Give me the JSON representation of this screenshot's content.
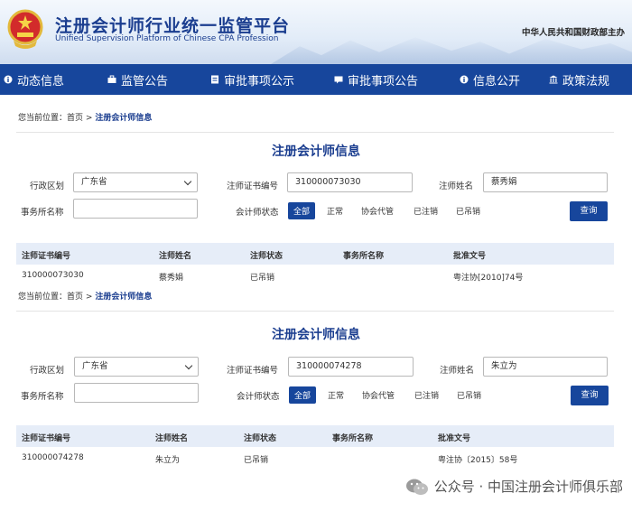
{
  "header": {
    "title": "注册会计师行业统一监管平台",
    "subtitle": "Unified Supervision Platform of Chinese CPA Profession",
    "ministry": "中华人民共和国财政部主办"
  },
  "nav": [
    {
      "label": "动态信息",
      "icon": "info-icon"
    },
    {
      "label": "监管公告",
      "icon": "briefcase-icon"
    },
    {
      "label": "审批事项公示",
      "icon": "document-icon"
    },
    {
      "label": "审批事项公告",
      "icon": "announce-icon"
    },
    {
      "label": "信息公开",
      "icon": "info-icon"
    },
    {
      "label": "政策法规",
      "icon": "building-icon"
    }
  ],
  "sections": [
    {
      "breadcrumb": {
        "prefix": "您当前位置：",
        "home": "首页",
        "sep": ">",
        "current": "注册会计师信息"
      },
      "title": "注册会计师信息",
      "form": {
        "region_label": "行政区划",
        "region_value": "广东省",
        "cert_label": "注师证书编号",
        "cert_value": "310000073030",
        "name_label": "注师姓名",
        "name_value": "蔡秀娟",
        "firm_label": "事务所名称",
        "firm_value": "",
        "status_label": "会计师状态",
        "status_options": [
          "全部",
          "正常",
          "协会代管",
          "已注销",
          "已吊销"
        ],
        "query_label": "查询"
      },
      "table": {
        "headers": [
          "注师证书编号",
          "注师姓名",
          "注师状态",
          "事务所名称",
          "批准文号"
        ],
        "rows": [
          [
            "310000073030",
            "蔡秀娟",
            "已吊销",
            "",
            "粤注协[2010]74号"
          ]
        ]
      }
    },
    {
      "breadcrumb": {
        "prefix": "您当前位置：",
        "home": "首页",
        "sep": ">",
        "current": "注册会计师信息"
      },
      "title": "注册会计师信息",
      "form": {
        "region_label": "行政区划",
        "region_value": "广东省",
        "cert_label": "注师证书编号",
        "cert_value": "310000074278",
        "name_label": "注师姓名",
        "name_value": "朱立为",
        "firm_label": "事务所名称",
        "firm_value": "",
        "status_label": "会计师状态",
        "status_options": [
          "全部",
          "正常",
          "协会代管",
          "已注销",
          "已吊销"
        ],
        "query_label": "查询"
      },
      "table": {
        "headers": [
          "注师证书编号",
          "注师姓名",
          "注师状态",
          "事务所名称",
          "批准文号"
        ],
        "rows": [
          [
            "310000074278",
            "朱立为",
            "已吊销",
            "",
            "粤注协〔2015〕58号"
          ]
        ]
      }
    }
  ],
  "watermark": "公众号 · 中国注册会计师俱乐部",
  "colors": {
    "primary": "#17469c",
    "title": "#1a3d8f",
    "table_header_bg": "#e6edf8"
  }
}
